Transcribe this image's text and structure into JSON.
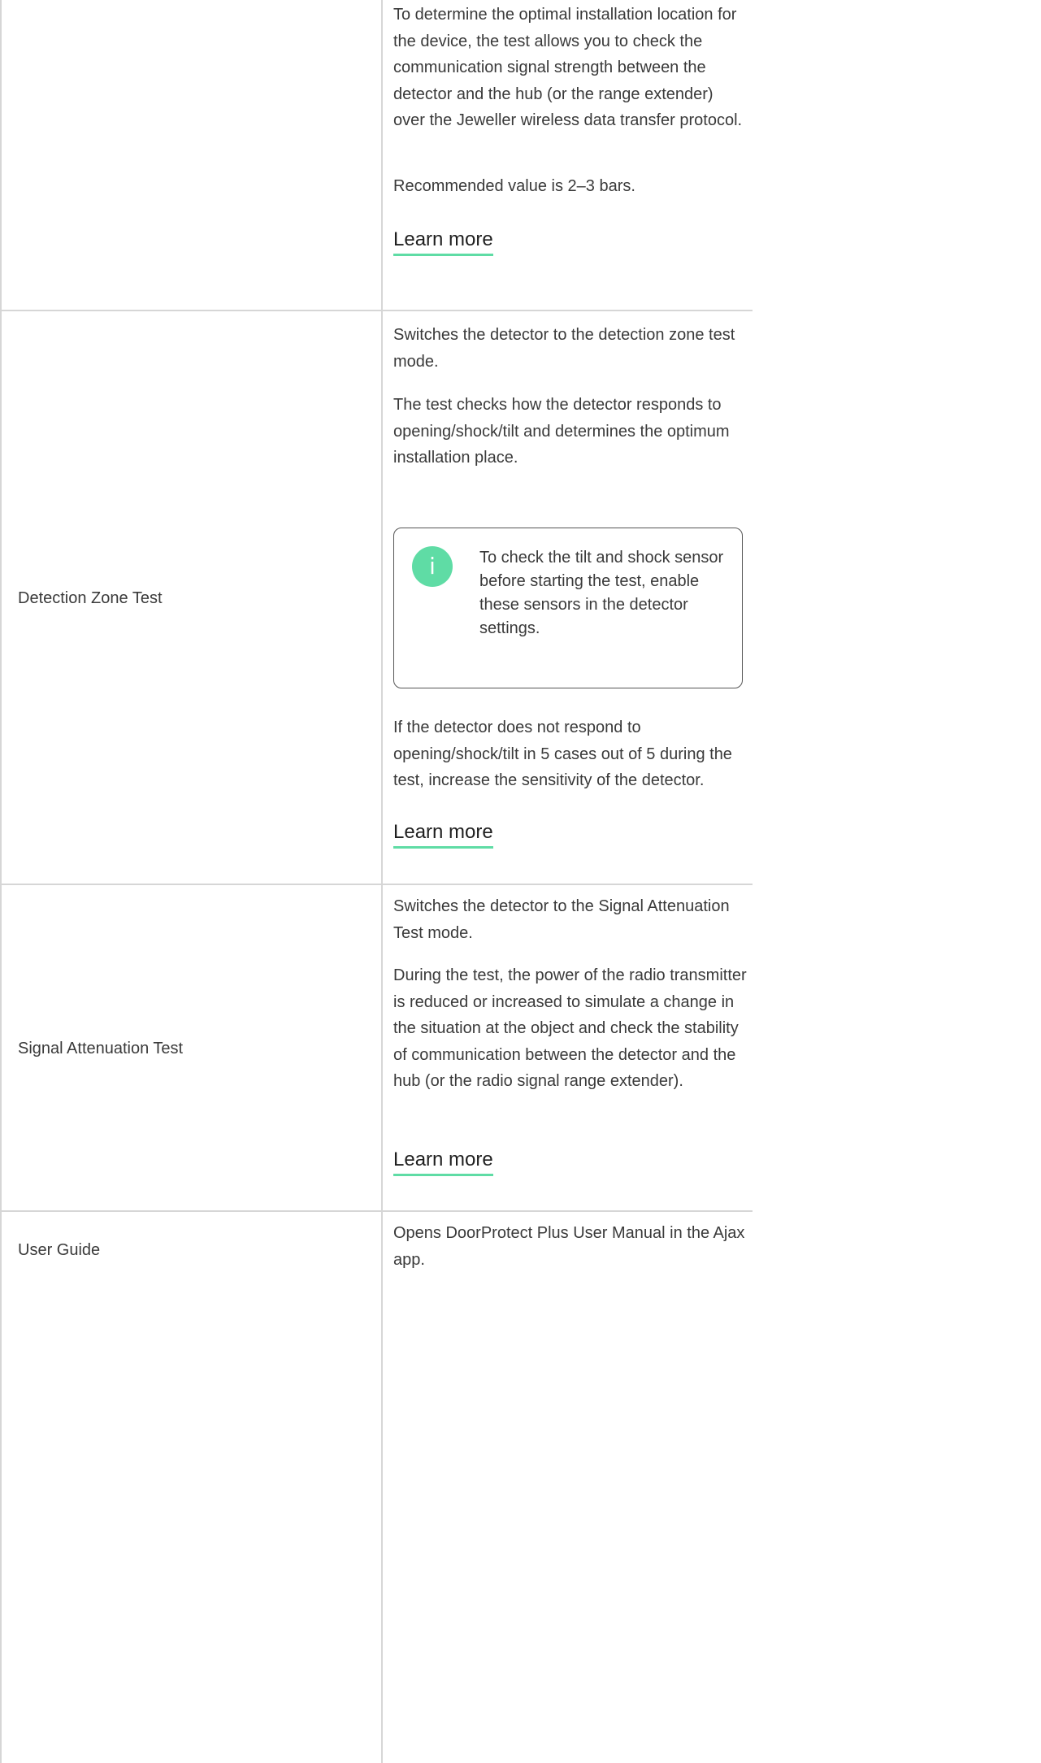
{
  "rows": [
    {
      "label": "",
      "paragraphs": [
        "To determine the optimal installation location for the device, the test allows you to check the communication signal strength between the detector and the hub (or the range extender) over the Jeweller wireless data transfer protocol.",
        "Recommended value is 2–3 bars."
      ],
      "link": "Learn more"
    },
    {
      "label": "Detection Zone Test",
      "paragraphs": [
        "Switches the detector to the detection zone test mode.",
        "The test checks how the detector responds to opening/shock/tilt and determines the optimum installation place.",
        "If the detector does not respond to opening/shock/tilt in 5 cases out of 5 during the test, increase the sensitivity of the detector."
      ],
      "info": {
        "icon": "info-icon",
        "glyph": "i",
        "text": "To check the tilt and shock sensor before starting the test, enable these sensors in the detector settings."
      },
      "link": "Learn more"
    },
    {
      "label": "Signal Attenuation Test",
      "paragraphs": [
        "Switches the detector to the Signal Attenuation Test mode.",
        "During the test, the power of the radio transmitter is reduced or increased to simulate a change in the situation at the object and check the stability of communication between the detector and the hub (or the radio signal range extender)."
      ],
      "link": "Learn more"
    },
    {
      "label": "User Guide",
      "paragraphs": [
        "Opens DoorProtect Plus User Manual in the Ajax app."
      ]
    }
  ],
  "colors": {
    "text": "#3a3a3a",
    "link_underline": "#5fdca5",
    "info_icon_bg": "#5fdca5",
    "grid_line": "#d6d6d6"
  }
}
